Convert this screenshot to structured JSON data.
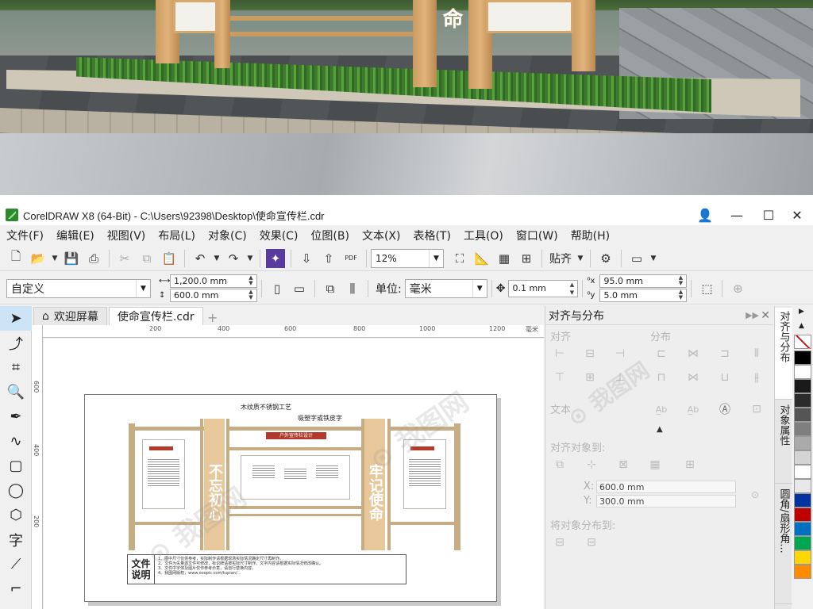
{
  "window": {
    "title": "CorelDRAW X8 (64-Bit) - C:\\Users\\92398\\Desktop\\使命宣传栏.cdr",
    "minimize": "—",
    "maximize": "☐",
    "close": "✕"
  },
  "menu": [
    "文件(F)",
    "编辑(E)",
    "视图(V)",
    "布局(L)",
    "对象(C)",
    "效果(C)",
    "位图(B)",
    "文本(X)",
    "表格(T)",
    "工具(O)",
    "窗口(W)",
    "帮助(H)"
  ],
  "toolbar": {
    "zoom": "12%",
    "snap_label": "贴齐",
    "pdf_label": "PDF"
  },
  "property_bar": {
    "page_preset": "自定义",
    "width": "1,200.0 mm",
    "height": "600.0 mm",
    "units_label": "单位:",
    "units": "毫米",
    "nudge": "0.1 mm",
    "dup_x": "95.0 mm",
    "dup_y": "5.0 mm"
  },
  "tabs": [
    {
      "label": "欢迎屏幕"
    },
    {
      "label": "使命宣传栏.cdr"
    }
  ],
  "ruler": {
    "h_ticks": [
      "200",
      "400",
      "600",
      "800",
      "1000",
      "1200",
      "毫米"
    ],
    "v_ticks": [
      "600",
      "400",
      "200"
    ]
  },
  "drawing": {
    "callout1": "木纹质不锈钢工艺",
    "callout2": "吸塑字或铁皮字",
    "header": "户外宣传栏设计",
    "left_vertical": "不忘初心",
    "right_vertical": "牢记使命",
    "note_title": "文件说明",
    "note_lines": [
      "1、图中尺寸仅供参考，实际制作请根据现场实际情况确定尺寸再制作。",
      "2、文件为矢量源文件可修改，标识牌请按实际尺寸制作。文字内容请根据实际情况修改确认。",
      "3、文件中字体及图片仅作参考示意，请自行替换内容。",
      "4、我图网版权，www.ooopic.com/tupian/..."
    ]
  },
  "docker": {
    "title": "对齐与分布",
    "align_label": "对齐",
    "distribute_label": "分布",
    "text_label": "文本",
    "align_to_label": "对齐对象到:",
    "x_label": "X:",
    "x_value": "600.0 mm",
    "y_label": "Y:",
    "y_value": "300.0 mm",
    "distribute_to_label": "将对象分布到:"
  },
  "side_tabs": [
    "对齐与分布",
    "对象属性",
    "圆角/扇形角..."
  ],
  "palette": [
    "#ffffff",
    "#000000",
    "#ffffff",
    "#1a1a1a",
    "#2b2b2b",
    "#555555",
    "#7f7f7f",
    "#aaaaaa",
    "#d4d4d4",
    "#ffffff",
    "#e8e8e8",
    "#0033a0",
    "#c00000",
    "#0070c0",
    "#00a651",
    "#ffd700",
    "#ff8c00"
  ],
  "scene": {
    "vertical_word": "命"
  }
}
